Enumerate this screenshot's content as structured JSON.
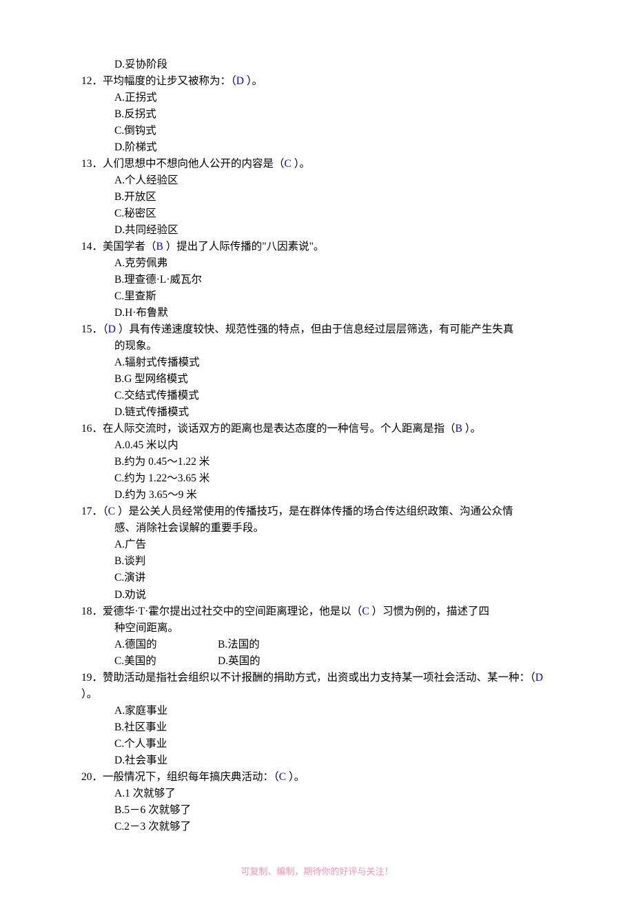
{
  "lead_option": "D.妥协阶段",
  "questions": [
    {
      "num": "12．",
      "pre": "平均幅度的让步又被称为：（",
      "ans": "D ",
      "post": "）。",
      "wrap": "",
      "opts": [
        "A.正拐式",
        "B.反拐式",
        "C.倒钩式",
        "D.阶梯式"
      ]
    },
    {
      "num": "13．",
      "pre": "人们思想中不想向他人公开的内容是（",
      "ans": "C ",
      "post": "）。",
      "wrap": "",
      "opts": [
        "A.个人经验区",
        "B.开放区",
        "C.秘密区",
        "D.共同经验区"
      ]
    },
    {
      "num": "14．",
      "pre": "美国学者（",
      "ans": "B ",
      "post": "）提出了人际传播的\"八因素说\"。",
      "wrap": "",
      "opts": [
        "A.克劳佩弗",
        "B.理查德·L·威瓦尔",
        "C.里查斯",
        "D.H·布鲁默"
      ]
    },
    {
      "num": "15．",
      "pre": "（",
      "ans": "D ",
      "post": "）具有传递速度较快、规范性强的特点，但由于信息经过层层筛选，有可能产生失真",
      "wrap": "的现象。",
      "opts": [
        "A.辐射式传播模式",
        "B.G 型网络模式",
        "C.交结式传播模式",
        "D.链式传播模式"
      ]
    },
    {
      "num": "16．",
      "pre": "在人际交流时，谈话双方的距离也是表达态度的一种信号。个人距离是指（",
      "ans": "B ",
      "post": "）。",
      "wrap": "",
      "opts": [
        "A.0.45 米以内",
        "B.约为 0.45～1.22 米",
        "C.约为 1.22～3.65 米",
        "D.约为 3.65～9 米"
      ]
    },
    {
      "num": "17．",
      "pre": "（",
      "ans": "C ",
      "post": "）是公关人员经常使用的传播技巧，是在群体传播的场合传达组织政策、沟通公众情",
      "wrap": "感、消除社会误解的重要手段。",
      "opts": [
        "A.广告",
        "B.谈判",
        "C.演讲",
        "D.劝说"
      ]
    },
    {
      "num": "18．",
      "pre": "爱德华·T·霍尔提出过社交中的空间距离理论，他是以（",
      "ans": "C ",
      "post": "）习惯为例的，描述了四",
      "wrap": "种空间距离。",
      "opts_grid": [
        [
          "A.德国的",
          "B.法国的"
        ],
        [
          "C.美国的",
          "D.英国的"
        ]
      ]
    },
    {
      "num": "19．",
      "pre": "赞助活动是指社会组织以不计报酬的捐助方式，出资或出力支持某一项社会活动、某一种：（",
      "ans": "D ",
      "post": "）。",
      "wrap": "",
      "opts": [
        "A.家庭事业",
        "B.社区事业",
        "C.个人事业",
        "D.社会事业"
      ]
    },
    {
      "num": "20．",
      "pre": "一般情况下，组织每年搞庆典活动：（",
      "ans": "C ",
      "post": "）。",
      "wrap": "",
      "opts": [
        "A.1 次就够了",
        "B.5－6 次就够了",
        "C.2－3 次就够了"
      ]
    }
  ],
  "footer": "可复制、编制，期待你的好评与关注！"
}
